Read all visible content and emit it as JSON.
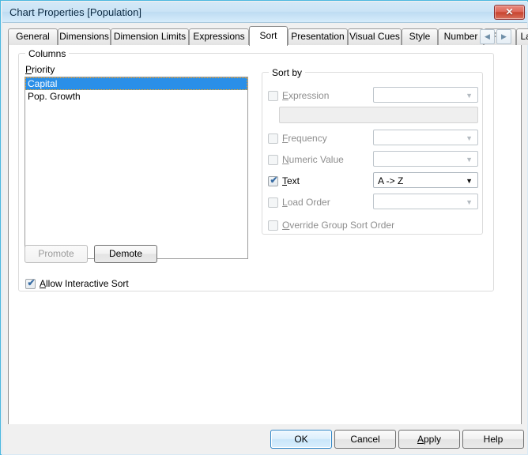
{
  "window": {
    "title": "Chart Properties [Population]",
    "close_label": "✕",
    "accent_border": "#4ab8e0",
    "titlebar_color": "#cbe4f6",
    "close_color": "#c8442f"
  },
  "tabs": {
    "items": [
      {
        "label": "General",
        "active": false
      },
      {
        "label": "Dimensions",
        "active": false
      },
      {
        "label": "Dimension Limits",
        "active": false
      },
      {
        "label": "Expressions",
        "active": false
      },
      {
        "label": "Sort",
        "active": true
      },
      {
        "label": "Presentation",
        "active": false
      },
      {
        "label": "Visual Cues",
        "active": false
      },
      {
        "label": "Style",
        "active": false
      },
      {
        "label": "Number",
        "active": false
      },
      {
        "label": "Font",
        "active": false
      },
      {
        "label": "Layo",
        "active": false
      }
    ],
    "scroll_prev": "◀",
    "scroll_next": "▶"
  },
  "columns_group": {
    "title": "Columns",
    "priority_label": "Priority",
    "items": [
      {
        "label": "Capital",
        "selected": true
      },
      {
        "label": "Pop. Growth",
        "selected": false
      }
    ],
    "promote_label": "Promote",
    "demote_label": "Demote"
  },
  "sort_by_group": {
    "title": "Sort by",
    "rows": [
      {
        "label": "Expression",
        "checked": false,
        "enabled": false,
        "combo_value": "",
        "combo_enabled": false
      },
      {
        "label": "Frequency",
        "checked": false,
        "enabled": false,
        "combo_value": "",
        "combo_enabled": false
      },
      {
        "label": "Numeric Value",
        "checked": false,
        "enabled": false,
        "combo_value": "",
        "combo_enabled": false
      },
      {
        "label": "Text",
        "checked": true,
        "enabled": true,
        "combo_value": "A -> Z",
        "combo_enabled": true
      },
      {
        "label": "Load Order",
        "checked": false,
        "enabled": false,
        "combo_value": "",
        "combo_enabled": false
      }
    ],
    "expression_field_value": "",
    "override_label": "Override Group Sort Order",
    "override_checked": false,
    "override_enabled": false
  },
  "options": {
    "allow_interactive_sort_label": "Allow Interactive Sort",
    "allow_interactive_sort_checked": true
  },
  "footer": {
    "ok_label": "OK",
    "cancel_label": "Cancel",
    "apply_label": "Apply",
    "help_label": "Help",
    "default_button": "OK"
  },
  "selection_color": "#2a8fe8",
  "check_color": "#3a6ea5"
}
